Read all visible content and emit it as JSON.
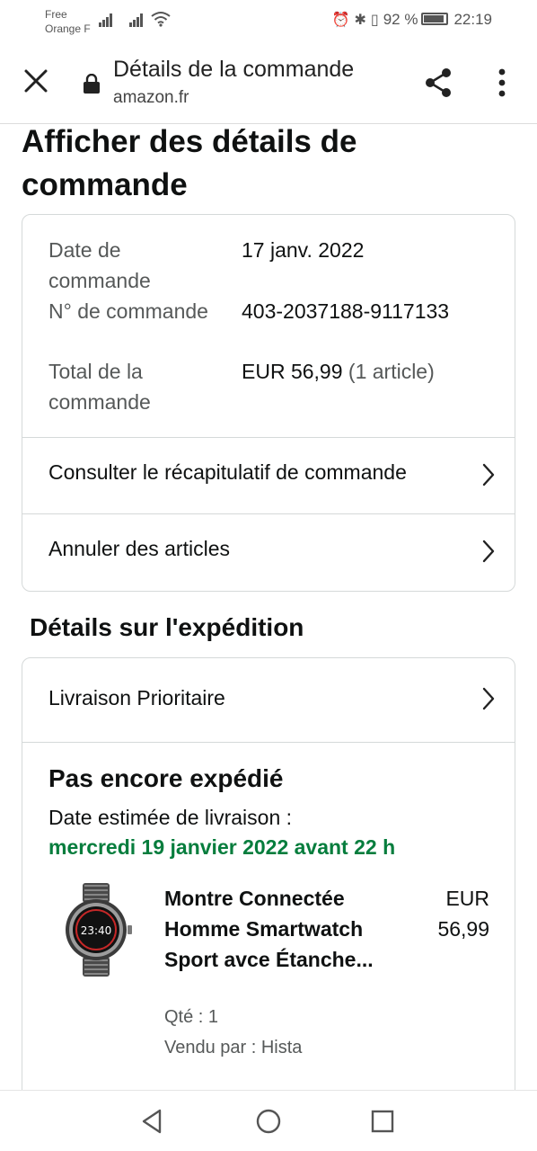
{
  "status_bar": {
    "carrier_line1": "Free",
    "carrier_line2": "Orange F",
    "battery_percent": "92 %",
    "time": "22:19"
  },
  "browser": {
    "page_title": "Détails de la commande",
    "url": "amazon.fr",
    "icons": [
      "close-icon",
      "lock-icon",
      "share-icon",
      "more-vert-icon"
    ]
  },
  "page": {
    "heading": "Afficher des détails de commande"
  },
  "order_info": {
    "date_label": "Date de commande",
    "date_value": "17 janv. 2022",
    "number_label": "N° de commande",
    "number_value": "403-2037188-9117133",
    "total_label": "Total de la commande",
    "total_value": "EUR 56,99",
    "total_items": "(1 article)"
  },
  "actions": {
    "summary_label": "Consulter le récapitulatif de commande",
    "cancel_label": "Annuler des articles"
  },
  "shipping": {
    "section_title": "Détails sur l'expédition",
    "delivery_option": "Livraison Prioritaire",
    "status": "Pas encore expédié",
    "estimate_label": "Date estimée de livraison :",
    "estimate_date": "mercredi 19 janvier 2022 avant 22 h",
    "estimate_color": "#067d3d"
  },
  "product": {
    "name": "Montre Connectée Homme Smartwatch Sport avce Étanche...",
    "price": "EUR 56,99",
    "quantity": "Qté : 1",
    "seller": "Vendu par : Hista",
    "watch_display": "23:40"
  },
  "nav": {
    "icons": [
      "back-icon",
      "home-icon",
      "recents-icon"
    ]
  }
}
